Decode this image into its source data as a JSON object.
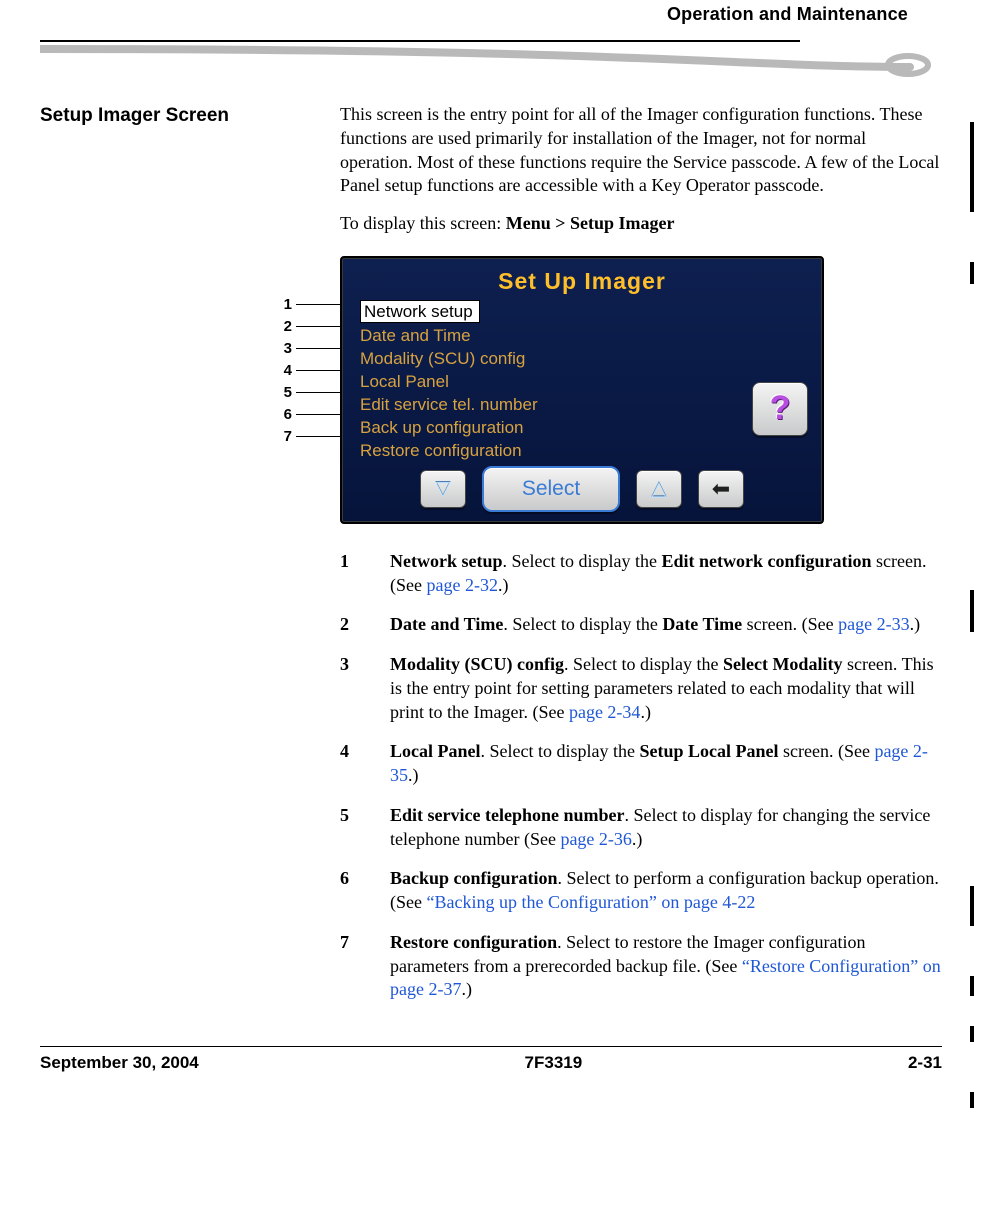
{
  "header": {
    "running": "Operation and Maintenance"
  },
  "side_heading": "Setup Imager Screen",
  "intro": {
    "p1": "This screen is the entry point for all of the Imager configuration functions. These functions are used primarily for installation of the Imager, not for normal operation. Most of these functions require the Service passcode. A few of the Local Panel setup functions are accessible with a Key Operator passcode.",
    "p2_a": "To display this screen: ",
    "p2_b": "Menu > Setup Imager"
  },
  "panel": {
    "title": "Set Up Imager",
    "items": [
      "Network setup",
      "Date and Time",
      "Modality (SCU) config",
      "Local Panel",
      "Edit service tel. number",
      "Back up configuration",
      "Restore configuration"
    ],
    "select_label": "Select",
    "help_label": "?"
  },
  "callout_nums": [
    "1",
    "2",
    "3",
    "4",
    "5",
    "6",
    "7"
  ],
  "items": [
    {
      "n": "1",
      "b1": "Network setup",
      "t1": ". Select to display the ",
      "b2": "Edit network configuration",
      "t2": " screen. (See ",
      "link": "page 2-32",
      "t3": ".)"
    },
    {
      "n": "2",
      "b1": "Date and Time",
      "t1": ". Select to display the ",
      "b2": "Date Time",
      "t2": " screen. (See ",
      "link": "page 2-33",
      "t3": ".)"
    },
    {
      "n": "3",
      "b1": "Modality (SCU) config",
      "t1": ". Select to display the ",
      "b2": "Select Modality",
      "t2": " screen. This is the entry point for setting parameters related to each modality that will print to the Imager. (See ",
      "link": "page 2-34",
      "t3": ".)"
    },
    {
      "n": "4",
      "b1": "Local Panel",
      "t1": ". Select to display the ",
      "b2": "Setup Local Panel",
      "t2": " screen. (See ",
      "link": "page 2-35",
      "t3": ".)"
    },
    {
      "n": "5",
      "b1": "Edit service telephone number",
      "t1": ". Select to display for changing the service telephone number (See ",
      "b2": "",
      "t2": "",
      "link": "page 2-36",
      "t3": ".)"
    },
    {
      "n": "6",
      "b1": "Backup configuration",
      "t1": ". Select to perform a configuration backup operation. (See ",
      "b2": "",
      "t2": "",
      "link": "“Backing up the Configuration” on page 4-22",
      "t3": ""
    },
    {
      "n": "7",
      "b1": "Restore configuration",
      "t1": ". Select to restore the Imager configuration parameters from a prerecorded backup file. (See ",
      "b2": "",
      "t2": "",
      "link": "“Restore Configuration” on page 2-37",
      "t3": ".)"
    }
  ],
  "footer": {
    "left": "September 30, 2004",
    "center": "7F3319",
    "right": "2-31"
  }
}
